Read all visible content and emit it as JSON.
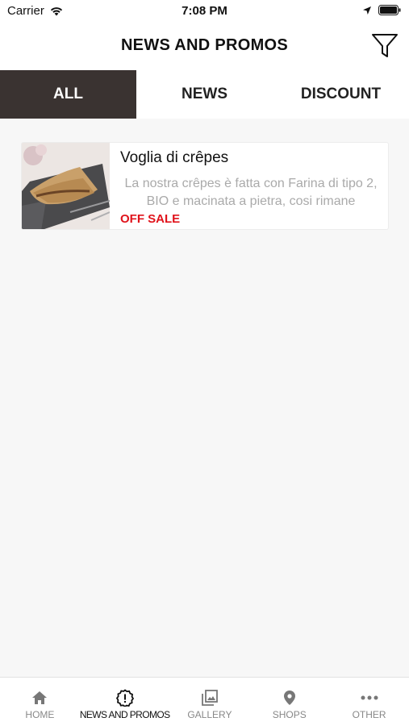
{
  "status_bar": {
    "carrier": "Carrier",
    "time": "7:08 PM"
  },
  "header": {
    "title": "NEWS AND PROMOS",
    "filter_icon": "filter-icon"
  },
  "tabs": [
    {
      "label": "ALL",
      "active": true
    },
    {
      "label": "NEWS",
      "active": false
    },
    {
      "label": "DISCOUNT",
      "active": false
    }
  ],
  "items": [
    {
      "title": "Voglia di crêpes",
      "description": "La nostra crêpes è fatta con Farina di tipo 2, BIO e macinata a pietra, cosi rimane",
      "badge": "OFF SALE",
      "badge_color": "#e0131b"
    }
  ],
  "bottom_nav": [
    {
      "label": "HOME",
      "icon": "home-icon",
      "active": false
    },
    {
      "label": "NEWS AND PROMOS",
      "icon": "alert-icon",
      "active": true
    },
    {
      "label": "GALLERY",
      "icon": "gallery-icon",
      "active": false
    },
    {
      "label": "SHOPS",
      "icon": "location-pin-icon",
      "active": false
    },
    {
      "label": "OTHER",
      "icon": "more-icon",
      "active": false
    }
  ],
  "colors": {
    "active_tab_bg": "#3a3331",
    "badge": "#e0131b",
    "background": "#f7f7f7"
  }
}
